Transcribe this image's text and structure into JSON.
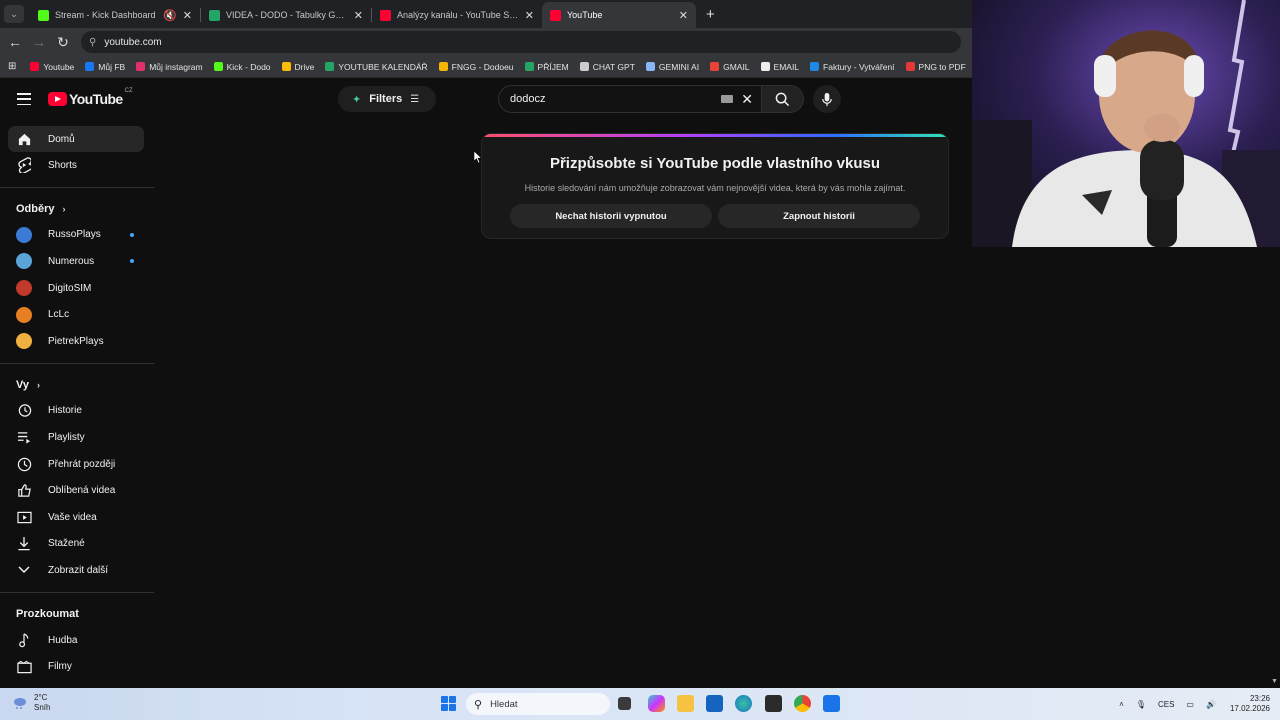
{
  "browser": {
    "tabs": [
      {
        "title": "Stream - Kick Dashboard",
        "favicon_color": "#53fc18",
        "muted": true
      },
      {
        "title": "VIDEA - DODO - Tabulky Google",
        "favicon_color": "#23a566"
      },
      {
        "title": "Analýzy kanálu - YouTube Studio",
        "favicon_color": "#ff0033"
      },
      {
        "title": "YouTube",
        "favicon_color": "#ff0033",
        "active": true
      }
    ],
    "new_tab": "+",
    "url": "youtube.com",
    "bookmarks": [
      {
        "label": "Youtube",
        "color": "#ff0033"
      },
      {
        "label": "Můj FB",
        "color": "#1877f2"
      },
      {
        "label": "Můj instagram",
        "color": "#e1306c"
      },
      {
        "label": "Kick - Dodo",
        "color": "#53fc18"
      },
      {
        "label": "Drive",
        "color": "#fbbc04"
      },
      {
        "label": "YOUTUBE KALENDÁŘ",
        "color": "#23a566"
      },
      {
        "label": "FNGG - Dodoeu",
        "color": "#f4b400"
      },
      {
        "label": "PŘÍJEM",
        "color": "#23a566"
      },
      {
        "label": "CHAT GPT",
        "color": "#cccccc"
      },
      {
        "label": "GEMINI AI",
        "color": "#8ab4f8"
      },
      {
        "label": "GMAIL",
        "color": "#ea4335"
      },
      {
        "label": "EMAIL",
        "color": "#eeeeee"
      },
      {
        "label": "Faktury - Vytváření",
        "color": "#1e88e5"
      },
      {
        "label": "PNG to PDF",
        "color": "#e53935"
      }
    ]
  },
  "youtube": {
    "logo_text": "YouTube",
    "region": "CZ",
    "filters_label": "Filters",
    "search": {
      "value": "dodocz"
    },
    "sidebar": {
      "main": [
        {
          "label": "Domů",
          "icon": "home-icon",
          "active": true
        },
        {
          "label": "Shorts",
          "icon": "shorts-icon"
        }
      ],
      "subscriptions_title": "Odběry",
      "subscriptions": [
        {
          "label": "RussoPlays",
          "avatar_color": "#3b7bd6",
          "new": true
        },
        {
          "label": "Numerous",
          "avatar_color": "#5ba4d8",
          "new": true
        },
        {
          "label": "DigitoSIM",
          "avatar_color": "#c0392b",
          "new": false
        },
        {
          "label": "LcLc",
          "avatar_color": "#e67e22",
          "new": false
        },
        {
          "label": "PietrekPlays",
          "avatar_color": "#f0b03f",
          "new": false
        }
      ],
      "you_title": "Vy",
      "you": [
        {
          "label": "Historie",
          "icon": "history-icon"
        },
        {
          "label": "Playlisty",
          "icon": "playlists-icon"
        },
        {
          "label": "Přehrát později",
          "icon": "watch-later-icon"
        },
        {
          "label": "Oblíbená videa",
          "icon": "liked-videos-icon"
        },
        {
          "label": "Vaše videa",
          "icon": "your-videos-icon"
        },
        {
          "label": "Stažené",
          "icon": "downloads-icon"
        },
        {
          "label": "Zobrazit další",
          "icon": "chevron-down-icon"
        }
      ],
      "explore_title": "Prozkoumat",
      "explore": [
        {
          "label": "Hudba",
          "icon": "music-icon"
        },
        {
          "label": "Filmy",
          "icon": "movies-icon"
        }
      ]
    },
    "history_card": {
      "title": "Přizpůsobte si YouTube podle vlastního vkusu",
      "description": "Historie sledování nám umožňuje zobrazovat vám nejnovější videa, která by vás mohla zajímat.",
      "keep_off_label": "Nechat historii vypnutou",
      "turn_on_label": "Zapnout historii"
    }
  },
  "taskbar": {
    "weather_temp": "2°C",
    "weather_desc": "Sníh",
    "search_placeholder": "Hledat",
    "language": "CES",
    "time": "23:26",
    "date": "17.02.2026"
  }
}
